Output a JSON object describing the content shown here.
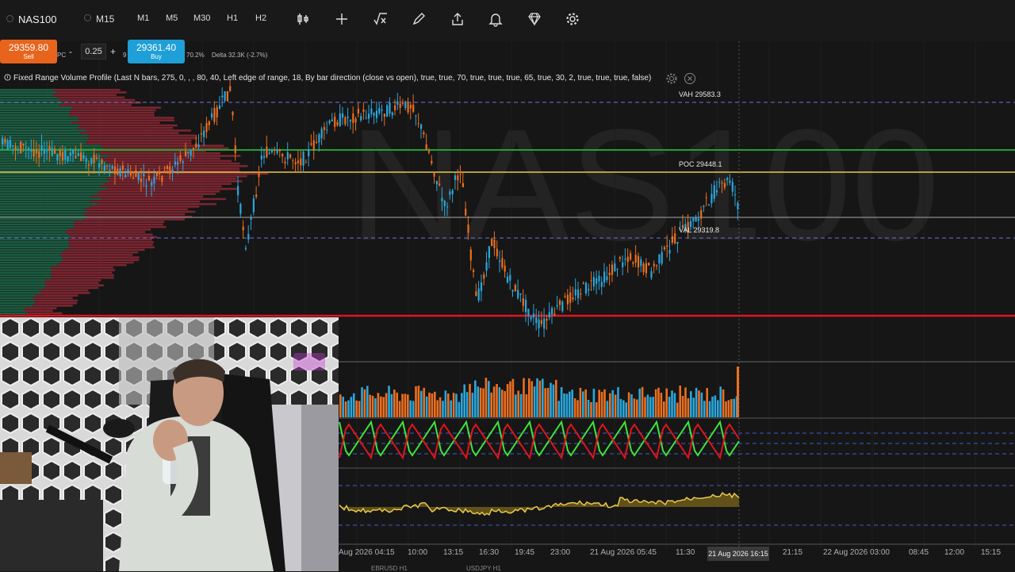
{
  "symbol": "NAS100",
  "timeframes": [
    "M15",
    "M1",
    "M5",
    "M30",
    "H1",
    "H2"
  ],
  "toolbar_icons": [
    "candle-settings-icon",
    "crosshair-icon",
    "function-icon",
    "pencil-icon",
    "share-icon",
    "alert-bell-icon",
    "diamond-icon",
    "gear-icon"
  ],
  "trade": {
    "sell_price": "29359.80",
    "sell_label": "Sell",
    "buy_price": "29361.40",
    "buy_label": "Buy",
    "qty": "0.25",
    "minus": "-",
    "plus": "+",
    "pc": "PC",
    "nine": "9",
    "pct": "70.2%",
    "delta": "Delta 32.3K (-2.7%)"
  },
  "indicator": {
    "title": "Fixed Range Volume Profile (Last N bars, 275, 0, , , 80, 40, Left edge of range, 18, By bar direction (close vs open), true, true, 70, true, true, true, 65, true, 30, 2, true, true, true, false)"
  },
  "watermark": "NAS100",
  "levels": {
    "vah": "VAH 29583.3",
    "poc": "POC 29448.1",
    "val": "VAL 29319.8"
  },
  "time_axis": [
    "Aug 2026 04:15",
    "10:00",
    "13:15",
    "16:30",
    "19:45",
    "23:00",
    "21 Aug 2026 05:45",
    "11:30",
    "21:15",
    "22 Aug 2026 03:00",
    "08:45",
    "12:00",
    "15:15"
  ],
  "time_highlight": "21 Aug 2026 16:15",
  "bottom_tabs": [
    "EBRUSD H1",
    "USDJPY H1"
  ],
  "colors": {
    "up": "#2aa7dd",
    "down": "#ec6f1f",
    "poc": "#e8c94a",
    "green_line": "#23a331",
    "red_line": "#e1141f"
  }
}
